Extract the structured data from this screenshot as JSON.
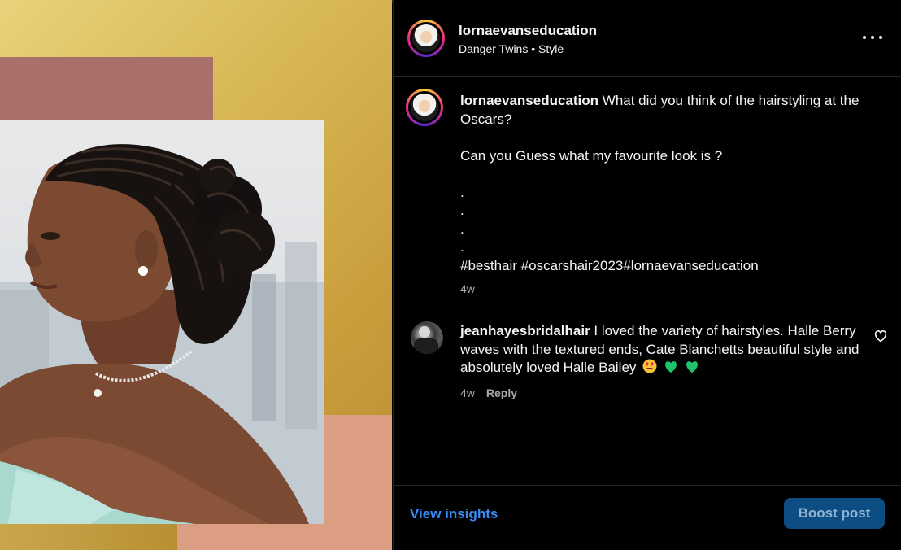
{
  "post": {
    "username": "lornaevanseducation",
    "audio_title": "Danger Twins",
    "separator": "•",
    "category": "Style"
  },
  "caption": {
    "username": "lornaevanseducation",
    "line1": " What did you think of the hairstyling at the Oscars?",
    "line2": "Can you Guess what my favourite look is ?",
    "dots": [
      ".",
      ".",
      ".",
      "."
    ],
    "hashtags": "#besthair #oscarshair2023#lornaevanseducation",
    "time": "4w"
  },
  "comment": {
    "username": "jeanhayesbridalhair",
    "text": " I loved the variety of hairstyles. Halle Berry waves with the textured ends, Cate Blanchetts beautiful style and absolutely loved Halle Bailey",
    "emojis": [
      "heart-eyes-emoji",
      "green-heart-emoji",
      "green-heart-emoji"
    ],
    "time": "4w",
    "reply_label": "Reply"
  },
  "footer": {
    "insights_label": "View insights",
    "boost_label": "Boost post"
  },
  "colors": {
    "background": "#000000",
    "link_blue": "#3a8cf4",
    "boost_button": "#0c4e84",
    "muted_text": "#a8a8a8",
    "image_gold": "#d8b855",
    "image_rose": "#a9706a",
    "image_peach": "#dc9e82"
  }
}
